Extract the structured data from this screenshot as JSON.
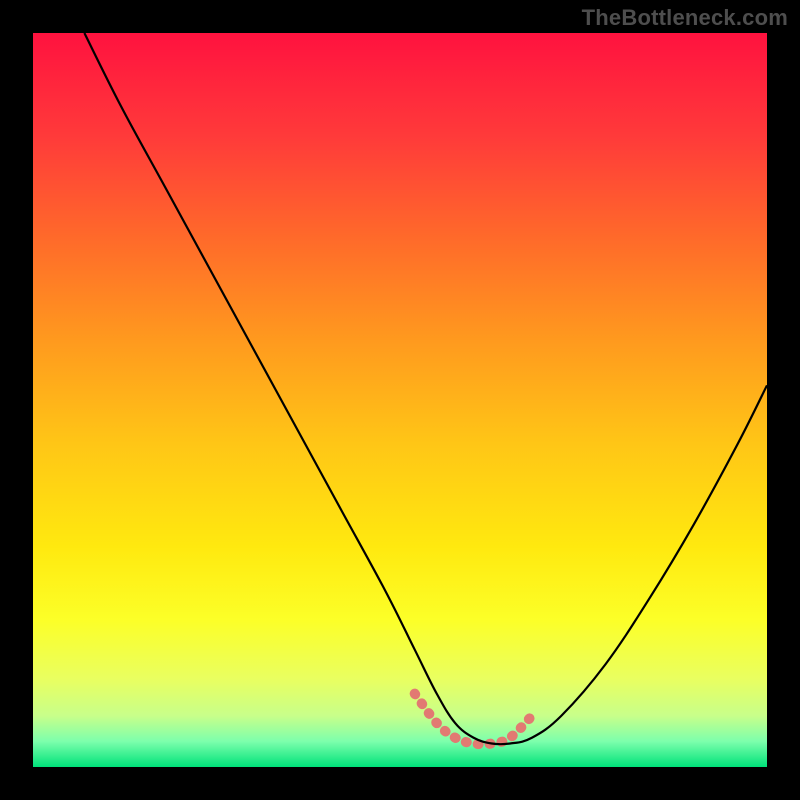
{
  "watermark": "TheBottleneck.com",
  "colors": {
    "gradient_stops": [
      {
        "offset": 0.0,
        "color": "#ff123f"
      },
      {
        "offset": 0.14,
        "color": "#ff3a3a"
      },
      {
        "offset": 0.28,
        "color": "#ff6a2a"
      },
      {
        "offset": 0.42,
        "color": "#ff9a1e"
      },
      {
        "offset": 0.56,
        "color": "#ffc616"
      },
      {
        "offset": 0.7,
        "color": "#ffe90f"
      },
      {
        "offset": 0.8,
        "color": "#fcff28"
      },
      {
        "offset": 0.88,
        "color": "#e9ff60"
      },
      {
        "offset": 0.93,
        "color": "#c8ff8a"
      },
      {
        "offset": 0.965,
        "color": "#7dffac"
      },
      {
        "offset": 1.0,
        "color": "#00e27a"
      }
    ],
    "curve": "#000000",
    "highlight": "#e27a72",
    "frame": "#000000"
  },
  "chart_data": {
    "type": "line",
    "title": "",
    "xlabel": "",
    "ylabel": "",
    "xlim": [
      0,
      100
    ],
    "ylim": [
      0,
      100
    ],
    "series": [
      {
        "name": "bottleneck-curve",
        "x": [
          7,
          12,
          18,
          24,
          30,
          36,
          42,
          48,
          52,
          55,
          57.5,
          60,
          62.5,
          65,
          68,
          72,
          78,
          84,
          90,
          96,
          100
        ],
        "values": [
          100,
          90,
          79,
          68,
          57,
          46,
          35,
          24,
          16,
          10,
          6,
          4,
          3.2,
          3.2,
          4,
          7,
          14,
          23,
          33,
          44,
          52
        ]
      }
    ],
    "highlight_segment": {
      "x": [
        52,
        55,
        57.5,
        60,
        62.5,
        65,
        68
      ],
      "values": [
        10,
        6,
        4,
        3.2,
        3.2,
        4,
        7
      ]
    }
  }
}
